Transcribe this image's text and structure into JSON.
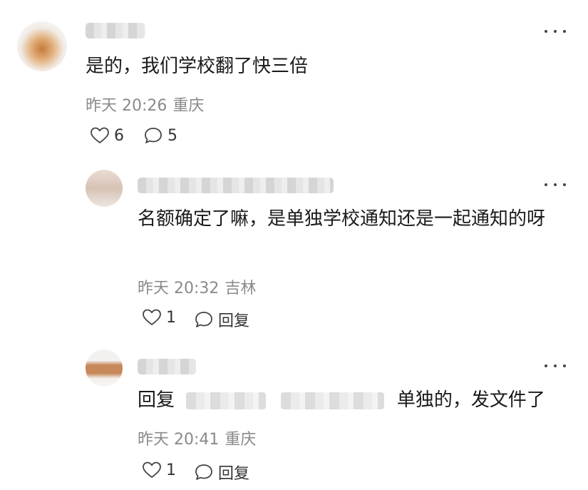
{
  "comment": {
    "text": "是的，我们学校翻了快三倍",
    "time": "昨天 20:26",
    "location": "重庆",
    "like_count": "6",
    "reply_count": "5"
  },
  "replies": [
    {
      "text": "名额确定了嘛，是单独学校通知还是一起通知的呀",
      "time": "昨天 20:32",
      "location": "吉林",
      "like_count": "1",
      "reply_label": "回复"
    },
    {
      "prefix": "回复",
      "text": "单独的，发文件了",
      "time": "昨天 20:41",
      "location": "重庆",
      "like_count": "1",
      "reply_label": "回复"
    }
  ],
  "icons": {
    "more": "more-horizontal-icon",
    "like": "heart-outline-icon",
    "comment": "comment-bubble-icon"
  }
}
